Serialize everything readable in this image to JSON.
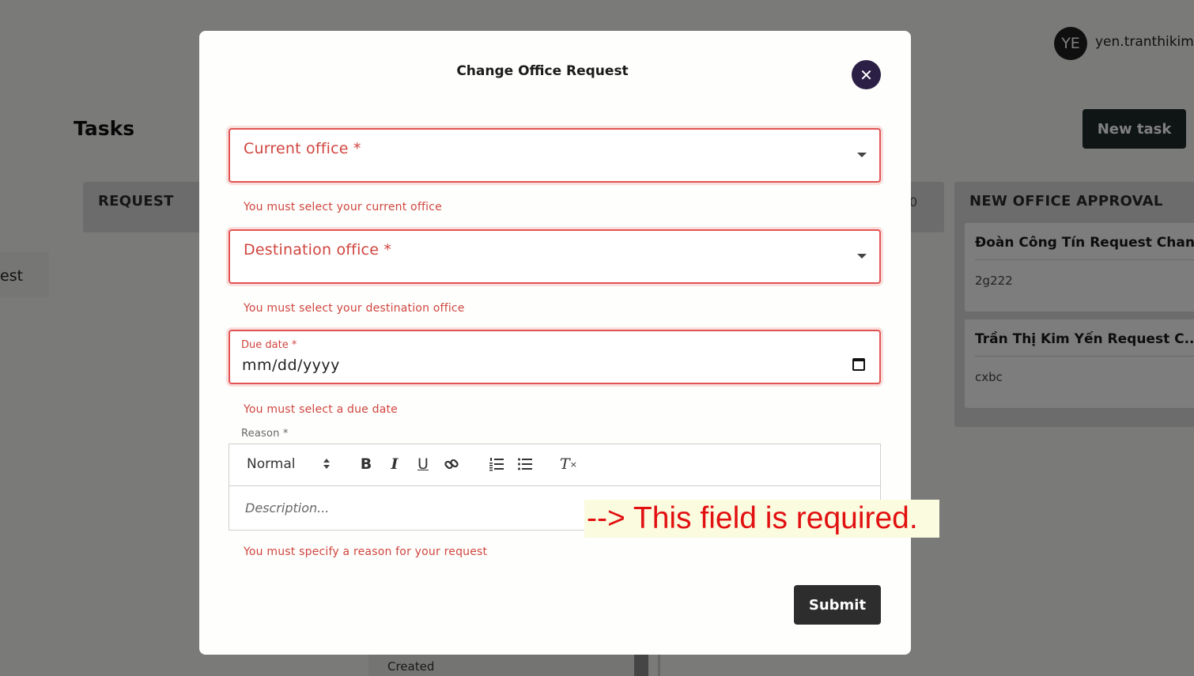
{
  "background": {
    "user": {
      "avatar_initials": "YE",
      "email": "yen.tranthikim@"
    },
    "page_title": "Tasks",
    "new_task_label": "New task",
    "columns": [
      {
        "title": "REQUEST"
      },
      {
        "count": "0"
      },
      {
        "title": "NEW OFFICE APPROVAL",
        "cards": [
          {
            "title": "Đoàn Công Tín Request Chan...",
            "description": "2g222"
          },
          {
            "title": "Trần Thị Kim Yến Request C...",
            "description": "cxbc"
          }
        ]
      }
    ],
    "side_item_label": "est",
    "bottom_card_label": "Created"
  },
  "modal": {
    "title": "Change Office Request",
    "close_icon": "close-icon",
    "current_office": {
      "label": "Current office *",
      "error": "You must select your current office"
    },
    "destination_office": {
      "label": "Destination office *",
      "error": "You must select your destination office"
    },
    "due_date": {
      "label": "Due date *",
      "value": "mm/dd/yyyy",
      "error": "You must select a due date"
    },
    "reason": {
      "label": "Reason *",
      "toolbar": {
        "format": "Normal",
        "bold": "B",
        "italic": "I",
        "underline": "U",
        "link_icon": "link-icon",
        "ordered_list_icon": "ordered-list-icon",
        "bullet_list_icon": "bullet-list-icon",
        "clean": "T"
      },
      "placeholder": "Description...",
      "error": "You must specify a reason for your request"
    },
    "submit_label": "Submit"
  },
  "annotation": "--> This field is required.",
  "colors": {
    "error": "#d0453f",
    "close_button": "#2b1f45",
    "submit_button": "#2d2d2d",
    "annotation_text": "#e21010",
    "annotation_bg": "#fbfbe0"
  }
}
